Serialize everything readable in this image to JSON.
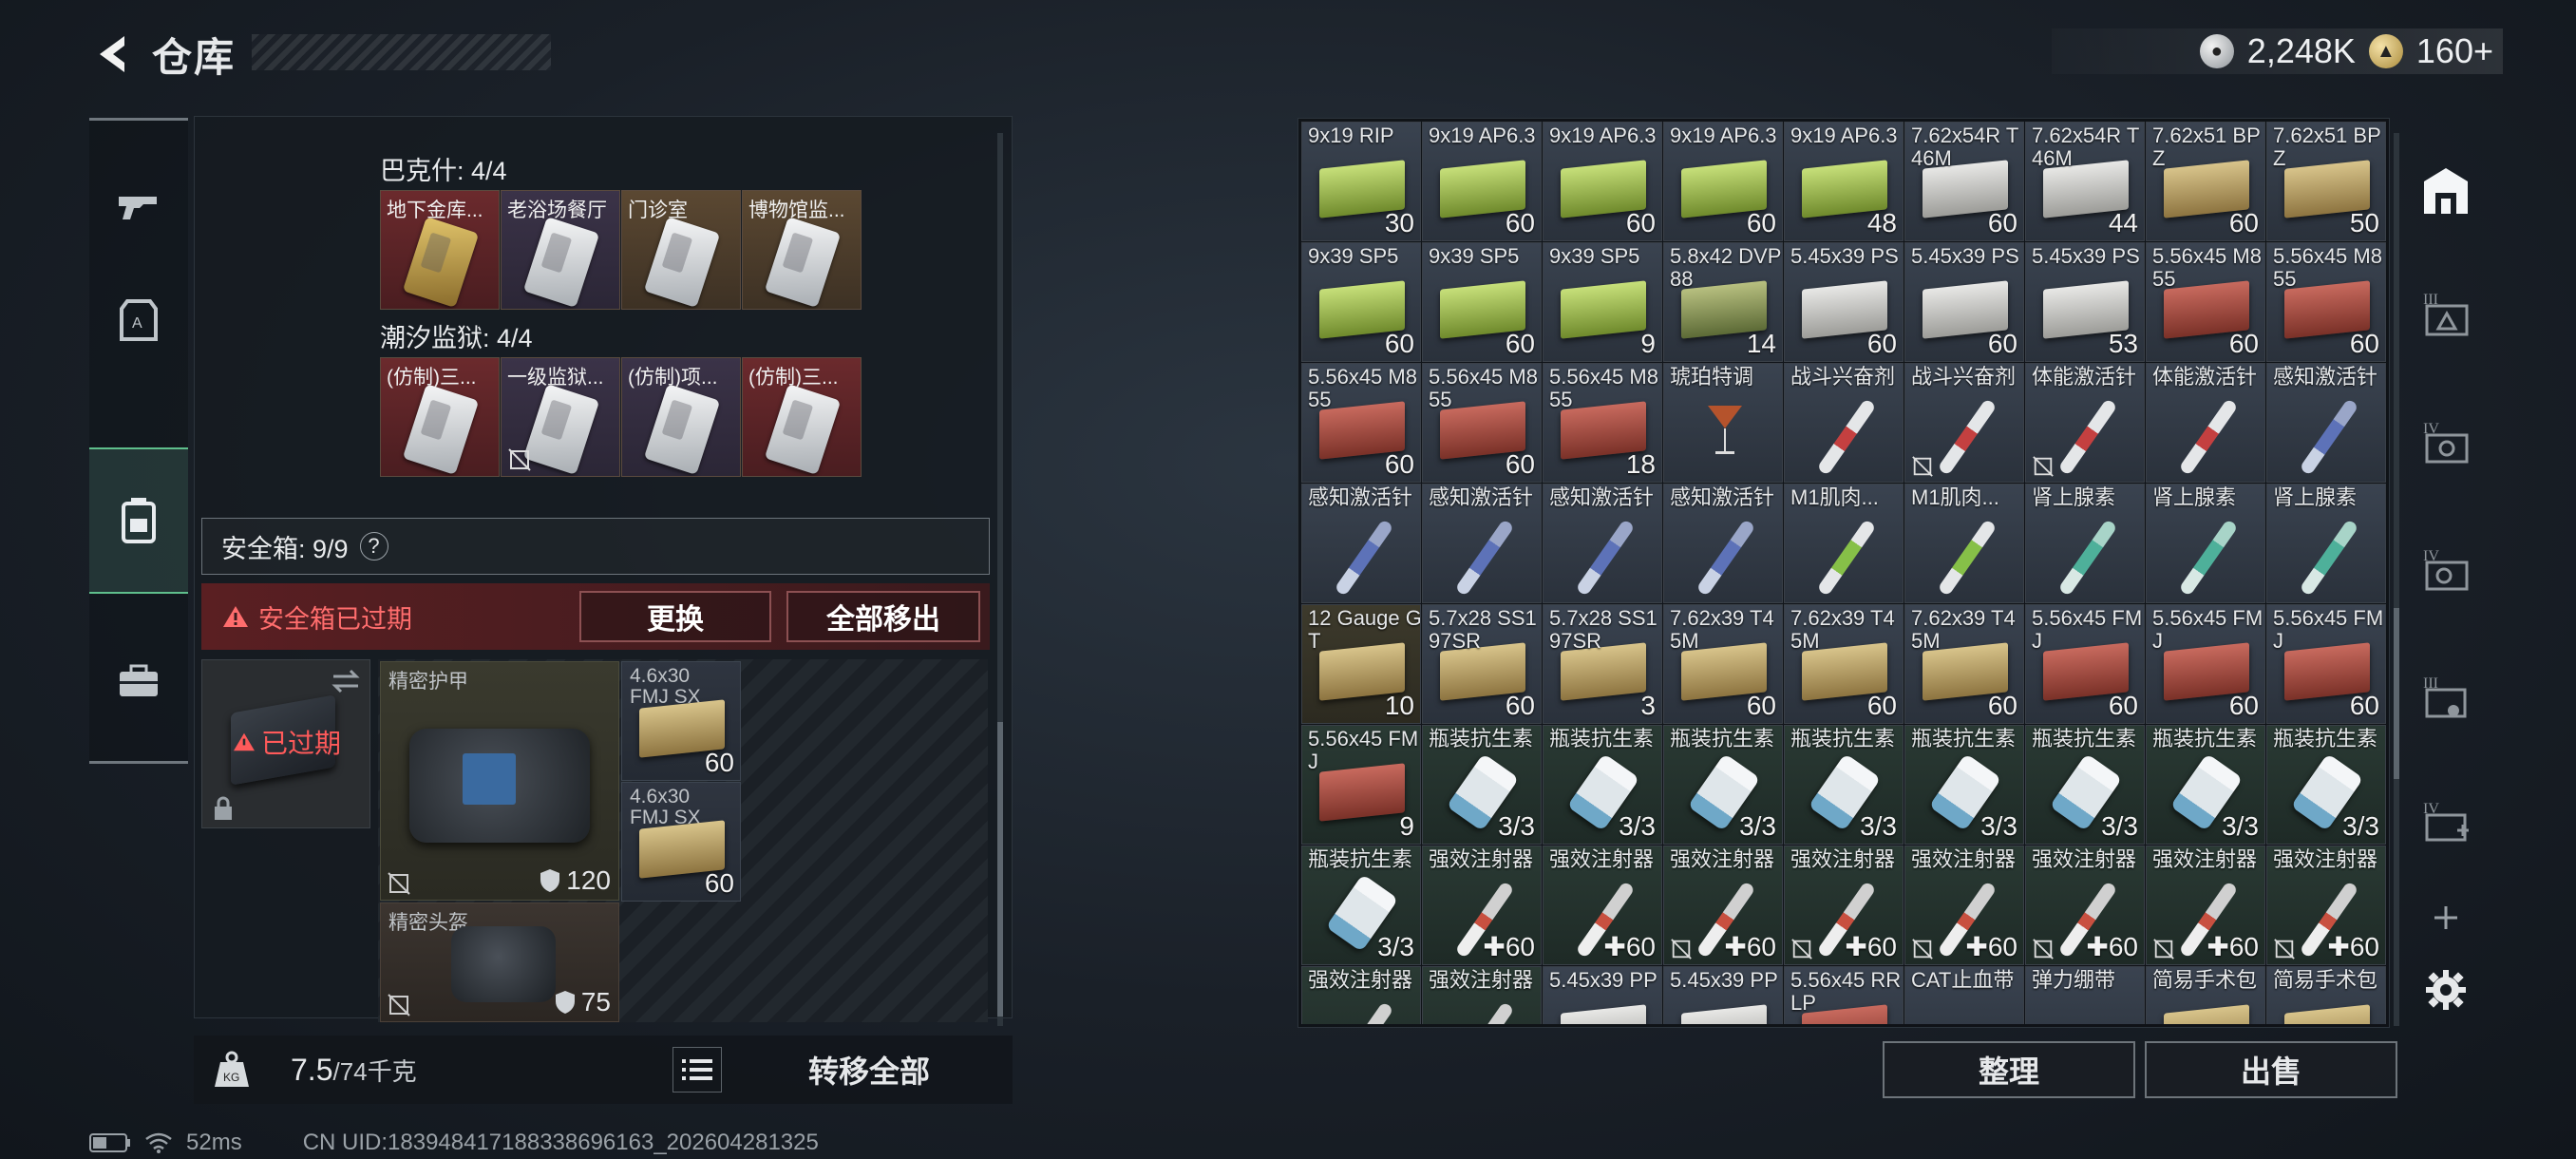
{
  "header": {
    "title": "仓库",
    "currencies": [
      {
        "icon": "silver-coin-icon",
        "value": "2,248K"
      },
      {
        "icon": "gold-coin-icon",
        "value": "160+"
      }
    ]
  },
  "left_nav": [
    "weapon-tab",
    "armor-tab",
    "backpack-tab",
    "case-tab"
  ],
  "keys": {
    "section1_label": "巴克什: 4/4",
    "section1_cards": [
      "地下金库...",
      "老浴场餐厅",
      "门诊室",
      "博物馆监..."
    ],
    "section2_label": "潮汐监狱: 4/4",
    "section2_cards": [
      "(仿制)三...",
      "一级监狱...",
      "(仿制)项...",
      "(仿制)三..."
    ]
  },
  "safebox": {
    "label": "安全箱: 9/9",
    "help": "?",
    "expired_text": "安全箱已过期",
    "replace_label": "更换",
    "remove_all_label": "全部移出",
    "slot_expired": "已过期",
    "armor_label": "精密护甲",
    "armor_durability": "120",
    "helmet_label": "精密头盔",
    "helmet_durability": "75",
    "ammo1_label": "4.6x30 FMJ SX",
    "ammo1_qty": "60",
    "ammo2_label": "4.6x30 FMJ SX",
    "ammo2_qty": "60"
  },
  "weight": {
    "value": "7.5",
    "cap": "/74千克"
  },
  "transfer_all_label": "转移全部",
  "status": {
    "ping": "52ms",
    "uid": "CN UID:18394841718833869616​3_202604281325"
  },
  "items": [
    {
      "label": "9x19 RIP",
      "qty": "30",
      "bg": "gray",
      "art": "box green"
    },
    {
      "label": "9x19 AP6.3",
      "qty": "60",
      "bg": "gray",
      "art": "box green"
    },
    {
      "label": "9x19 AP6.3",
      "qty": "60",
      "bg": "gray",
      "art": "box green"
    },
    {
      "label": "9x19 AP6.3",
      "qty": "60",
      "bg": "gray",
      "art": "box green"
    },
    {
      "label": "9x19 AP6.3",
      "qty": "48",
      "bg": "gray",
      "art": "box green"
    },
    {
      "label": "7.62x54R T46M",
      "qty": "60",
      "bg": "gray",
      "art": "box white"
    },
    {
      "label": "7.62x54R T46M",
      "qty": "44",
      "bg": "gray",
      "art": "box white"
    },
    {
      "label": "7.62x51 BPZ",
      "qty": "60",
      "bg": "gray",
      "art": "box tan"
    },
    {
      "label": "7.62x51 BPZ",
      "qty": "50",
      "bg": "gray",
      "art": "box tan"
    },
    {
      "label": "9x39 SP5",
      "qty": "60",
      "bg": "gray",
      "art": "box green"
    },
    {
      "label": "9x39 SP5",
      "qty": "60",
      "bg": "gray",
      "art": "box green"
    },
    {
      "label": "9x39 SP5",
      "qty": "9",
      "bg": "gray",
      "art": "box green"
    },
    {
      "label": "5.8x42 DVP88",
      "qty": "14",
      "bg": "gray",
      "art": "box olive"
    },
    {
      "label": "5.45x39 PS",
      "qty": "60",
      "bg": "gray",
      "art": "box white"
    },
    {
      "label": "5.45x39 PS",
      "qty": "60",
      "bg": "gray",
      "art": "box white"
    },
    {
      "label": "5.45x39 PS",
      "qty": "53",
      "bg": "gray",
      "art": "box white"
    },
    {
      "label": "5.56x45 M855",
      "qty": "60",
      "bg": "gray",
      "art": "box red"
    },
    {
      "label": "5.56x45 M855",
      "qty": "60",
      "bg": "gray",
      "art": "box red"
    },
    {
      "label": "5.56x45 M855",
      "qty": "60",
      "bg": "gray",
      "art": "box red"
    },
    {
      "label": "5.56x45 M855",
      "qty": "60",
      "bg": "gray",
      "art": "box red"
    },
    {
      "label": "5.56x45 M855",
      "qty": "18",
      "bg": "gray",
      "art": "box red"
    },
    {
      "label": "琥珀特调",
      "qty": "",
      "bg": "gray",
      "art": "cocktail"
    },
    {
      "label": "战斗兴奋剂",
      "qty": "",
      "bg": "gray",
      "art": "syringe red"
    },
    {
      "label": "战斗兴奋剂",
      "qty": "",
      "bg": "gray",
      "art": "syringe red",
      "nd": true
    },
    {
      "label": "体能激活针",
      "qty": "",
      "bg": "gray",
      "art": "syringe red",
      "nd": true
    },
    {
      "label": "体能激活针",
      "qty": "",
      "bg": "gray",
      "art": "syringe red"
    },
    {
      "label": "感知激活针",
      "qty": "",
      "bg": "gray",
      "art": "syringe blue"
    },
    {
      "label": "感知激活针",
      "qty": "",
      "bg": "gray",
      "art": "syringe blue"
    },
    {
      "label": "感知激活针",
      "qty": "",
      "bg": "gray",
      "art": "syringe blue"
    },
    {
      "label": "感知激活针",
      "qty": "",
      "bg": "gray",
      "art": "syringe blue"
    },
    {
      "label": "感知激活针",
      "qty": "",
      "bg": "gray",
      "art": "syringe blue"
    },
    {
      "label": "M1肌肉...",
      "qty": "",
      "bg": "gray",
      "art": "syringe lime"
    },
    {
      "label": "M1肌肉...",
      "qty": "",
      "bg": "gray",
      "art": "syringe lime"
    },
    {
      "label": "肾上腺素",
      "qty": "",
      "bg": "gray",
      "art": "syringe teal"
    },
    {
      "label": "肾上腺素",
      "qty": "",
      "bg": "gray",
      "art": "syringe teal"
    },
    {
      "label": "肾上腺素",
      "qty": "",
      "bg": "gray",
      "art": "syringe teal"
    },
    {
      "label": "12 Gauge GT",
      "qty": "10",
      "bg": "gold",
      "art": "box tan"
    },
    {
      "label": "5.7x28 SS197SR",
      "qty": "60",
      "bg": "gray",
      "art": "box tan"
    },
    {
      "label": "5.7x28 SS197SR",
      "qty": "3",
      "bg": "gray",
      "art": "box tan"
    },
    {
      "label": "7.62x39 T45M",
      "qty": "60",
      "bg": "gray",
      "art": "box tan"
    },
    {
      "label": "7.62x39 T45M",
      "qty": "60",
      "bg": "gray",
      "art": "box tan"
    },
    {
      "label": "7.62x39 T45M",
      "qty": "60",
      "bg": "gray",
      "art": "box tan"
    },
    {
      "label": "5.56x45 FMJ",
      "qty": "60",
      "bg": "gray",
      "art": "box red"
    },
    {
      "label": "5.56x45 FMJ",
      "qty": "60",
      "bg": "gray",
      "art": "box red"
    },
    {
      "label": "5.56x45 FMJ",
      "qty": "60",
      "bg": "gray",
      "art": "box red"
    },
    {
      "label": "5.56x45 FMJ",
      "qty": "9",
      "bg": "green",
      "art": "box red"
    },
    {
      "label": "瓶装抗生素",
      "qty": "3/3",
      "bg": "green",
      "art": "bottle"
    },
    {
      "label": "瓶装抗生素",
      "qty": "3/3",
      "bg": "green",
      "art": "bottle"
    },
    {
      "label": "瓶装抗生素",
      "qty": "3/3",
      "bg": "green",
      "art": "bottle"
    },
    {
      "label": "瓶装抗生素",
      "qty": "3/3",
      "bg": "green",
      "art": "bottle"
    },
    {
      "label": "瓶装抗生素",
      "qty": "3/3",
      "bg": "green",
      "art": "bottle"
    },
    {
      "label": "瓶装抗生素",
      "qty": "3/3",
      "bg": "green",
      "art": "bottle"
    },
    {
      "label": "瓶装抗生素",
      "qty": "3/3",
      "bg": "green",
      "art": "bottle"
    },
    {
      "label": "瓶装抗生素",
      "qty": "3/3",
      "bg": "green",
      "art": "bottle"
    },
    {
      "label": "瓶装抗生素",
      "qty": "3/3",
      "bg": "green",
      "art": "bottle"
    },
    {
      "label": "强效注射器",
      "qty": "✚60",
      "bg": "green",
      "art": "syringe white"
    },
    {
      "label": "强效注射器",
      "qty": "✚60",
      "bg": "green",
      "art": "syringe white"
    },
    {
      "label": "强效注射器",
      "qty": "✚60",
      "bg": "green",
      "art": "syringe white",
      "nd": true
    },
    {
      "label": "强效注射器",
      "qty": "✚60",
      "bg": "green",
      "art": "syringe white",
      "nd": true
    },
    {
      "label": "强效注射器",
      "qty": "✚60",
      "bg": "green",
      "art": "syringe white",
      "nd": true
    },
    {
      "label": "强效注射器",
      "qty": "✚60",
      "bg": "green",
      "art": "syringe white",
      "nd": true
    },
    {
      "label": "强效注射器",
      "qty": "✚60",
      "bg": "green",
      "art": "syringe white",
      "nd": true
    },
    {
      "label": "强效注射器",
      "qty": "✚60",
      "bg": "green",
      "art": "syringe white",
      "nd": true
    },
    {
      "label": "强效注射器",
      "qty": "",
      "bg": "green",
      "art": "syringe white"
    },
    {
      "label": "强效注射器",
      "qty": "",
      "bg": "green",
      "art": "syringe white"
    },
    {
      "label": "5.45x39 PP",
      "qty": "",
      "bg": "gray",
      "art": "box white"
    },
    {
      "label": "5.45x39 PP",
      "qty": "",
      "bg": "gray",
      "art": "box white"
    },
    {
      "label": "5.56x45 RRLP",
      "qty": "",
      "bg": "gray",
      "art": "box red"
    },
    {
      "label": "CAT止血带",
      "qty": "",
      "bg": "gray",
      "art": ""
    },
    {
      "label": "弹力绷带",
      "qty": "",
      "bg": "gray",
      "art": ""
    },
    {
      "label": "简易手术包",
      "qty": "",
      "bg": "gray",
      "art": "box tan"
    },
    {
      "label": "简易手术包",
      "qty": "",
      "bg": "gray",
      "art": "box tan"
    }
  ],
  "right_buttons": {
    "sort_label": "整理",
    "sell_label": "出售"
  },
  "right_column": [
    "stash-icon",
    "tier3-case-icon",
    "tier4-case-icon",
    "tier4-case-icon",
    "tier3-case-icon",
    "tier4-medkit-icon",
    "add-icon",
    "settings-icon"
  ]
}
